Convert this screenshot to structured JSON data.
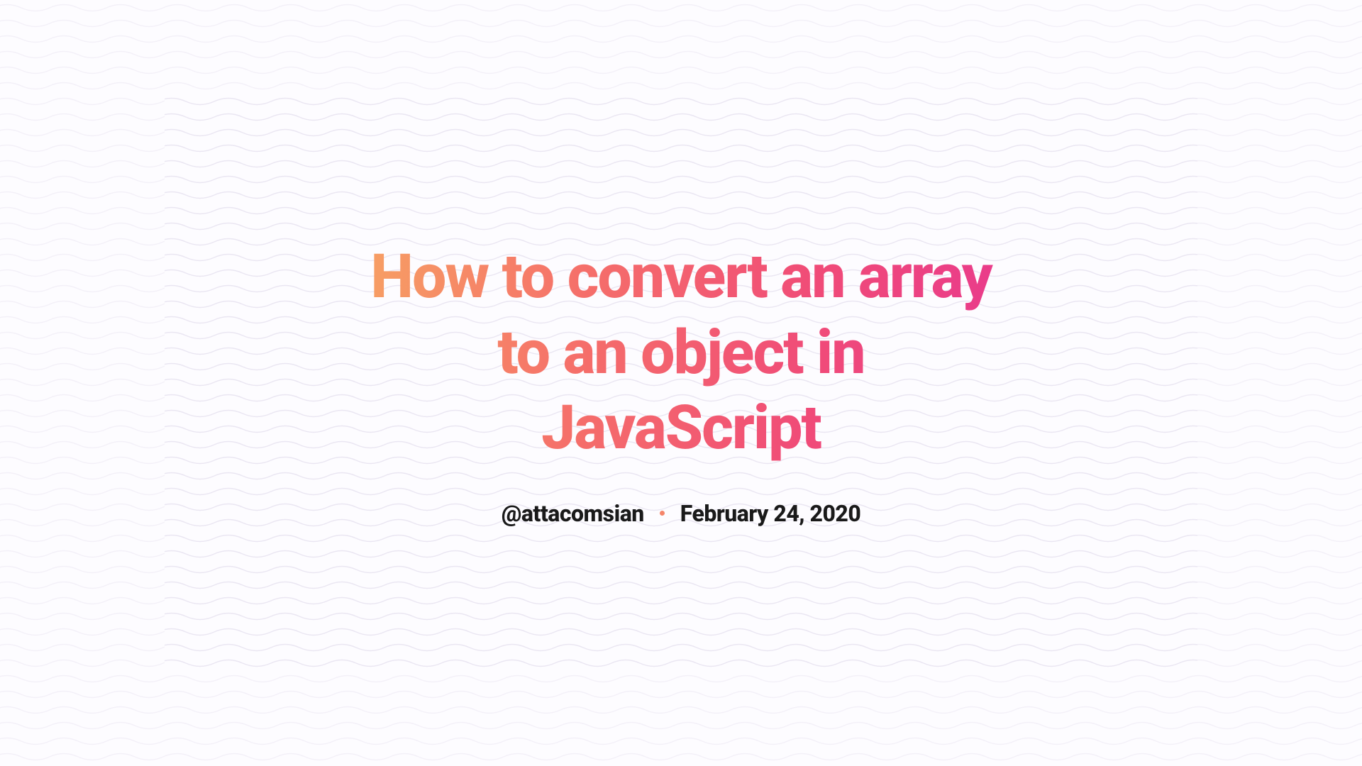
{
  "article": {
    "title": "How to convert an array to an object in JavaScript",
    "author_handle": "@attacomsian",
    "publish_date": "February 24, 2020"
  },
  "colors": {
    "gradient_start": "#f7a064",
    "gradient_mid1": "#f56e6a",
    "gradient_mid2": "#f04b78",
    "gradient_end": "#e93a8c",
    "background": "#fdfcff",
    "text_dark": "#1a1a1a",
    "separator": "#f5856a",
    "wave_stroke": "#eae6f2"
  }
}
